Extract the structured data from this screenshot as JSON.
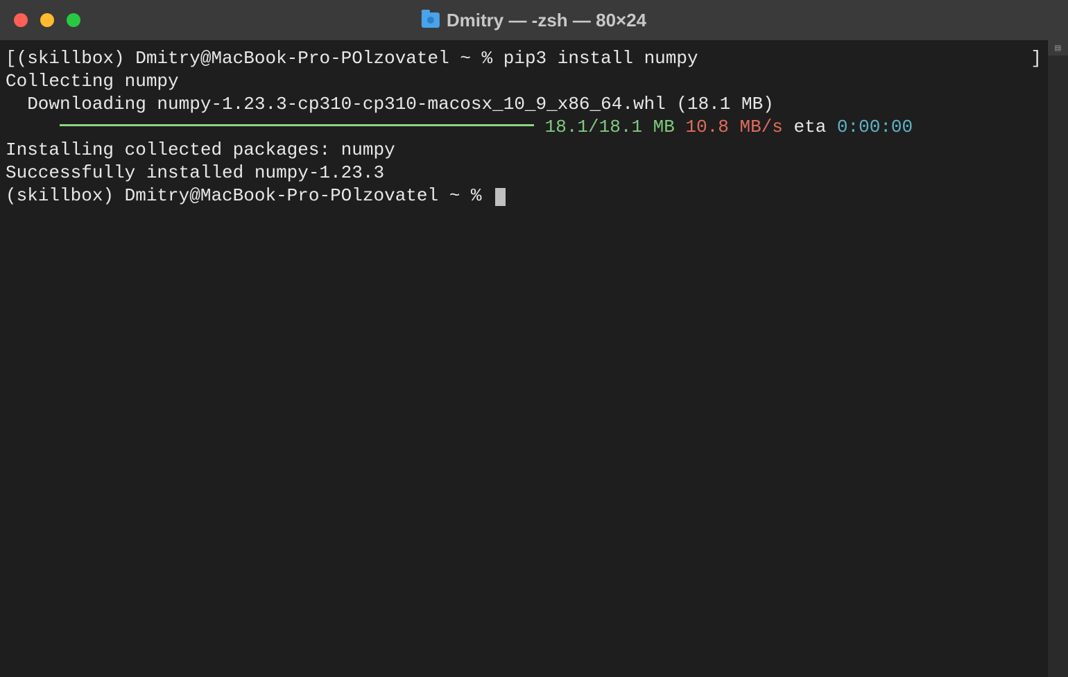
{
  "window": {
    "title": "Dmitry — -zsh — 80×24"
  },
  "terminal": {
    "line1_left_bracket": "[",
    "line1_prompt": "(skillbox) Dmitry@MacBook-Pro-POlzovatel ~ % ",
    "line1_command": "pip3 install numpy",
    "line1_right_bracket": "]",
    "line2": "Collecting numpy",
    "line3": "  Downloading numpy-1.23.3-cp310-cp310-macosx_10_9_x86_64.whl (18.1 MB)",
    "progress_spaces": "     ",
    "progress_size": "18.1/18.1 MB",
    "progress_speed": " 10.8 MB/s",
    "progress_eta_label": " eta ",
    "progress_eta": "0:00:00",
    "line5": "Installing collected packages: numpy",
    "line6": "Successfully installed numpy-1.23.3",
    "line7_prompt": "(skillbox) Dmitry@MacBook-Pro-POlzovatel ~ % "
  }
}
